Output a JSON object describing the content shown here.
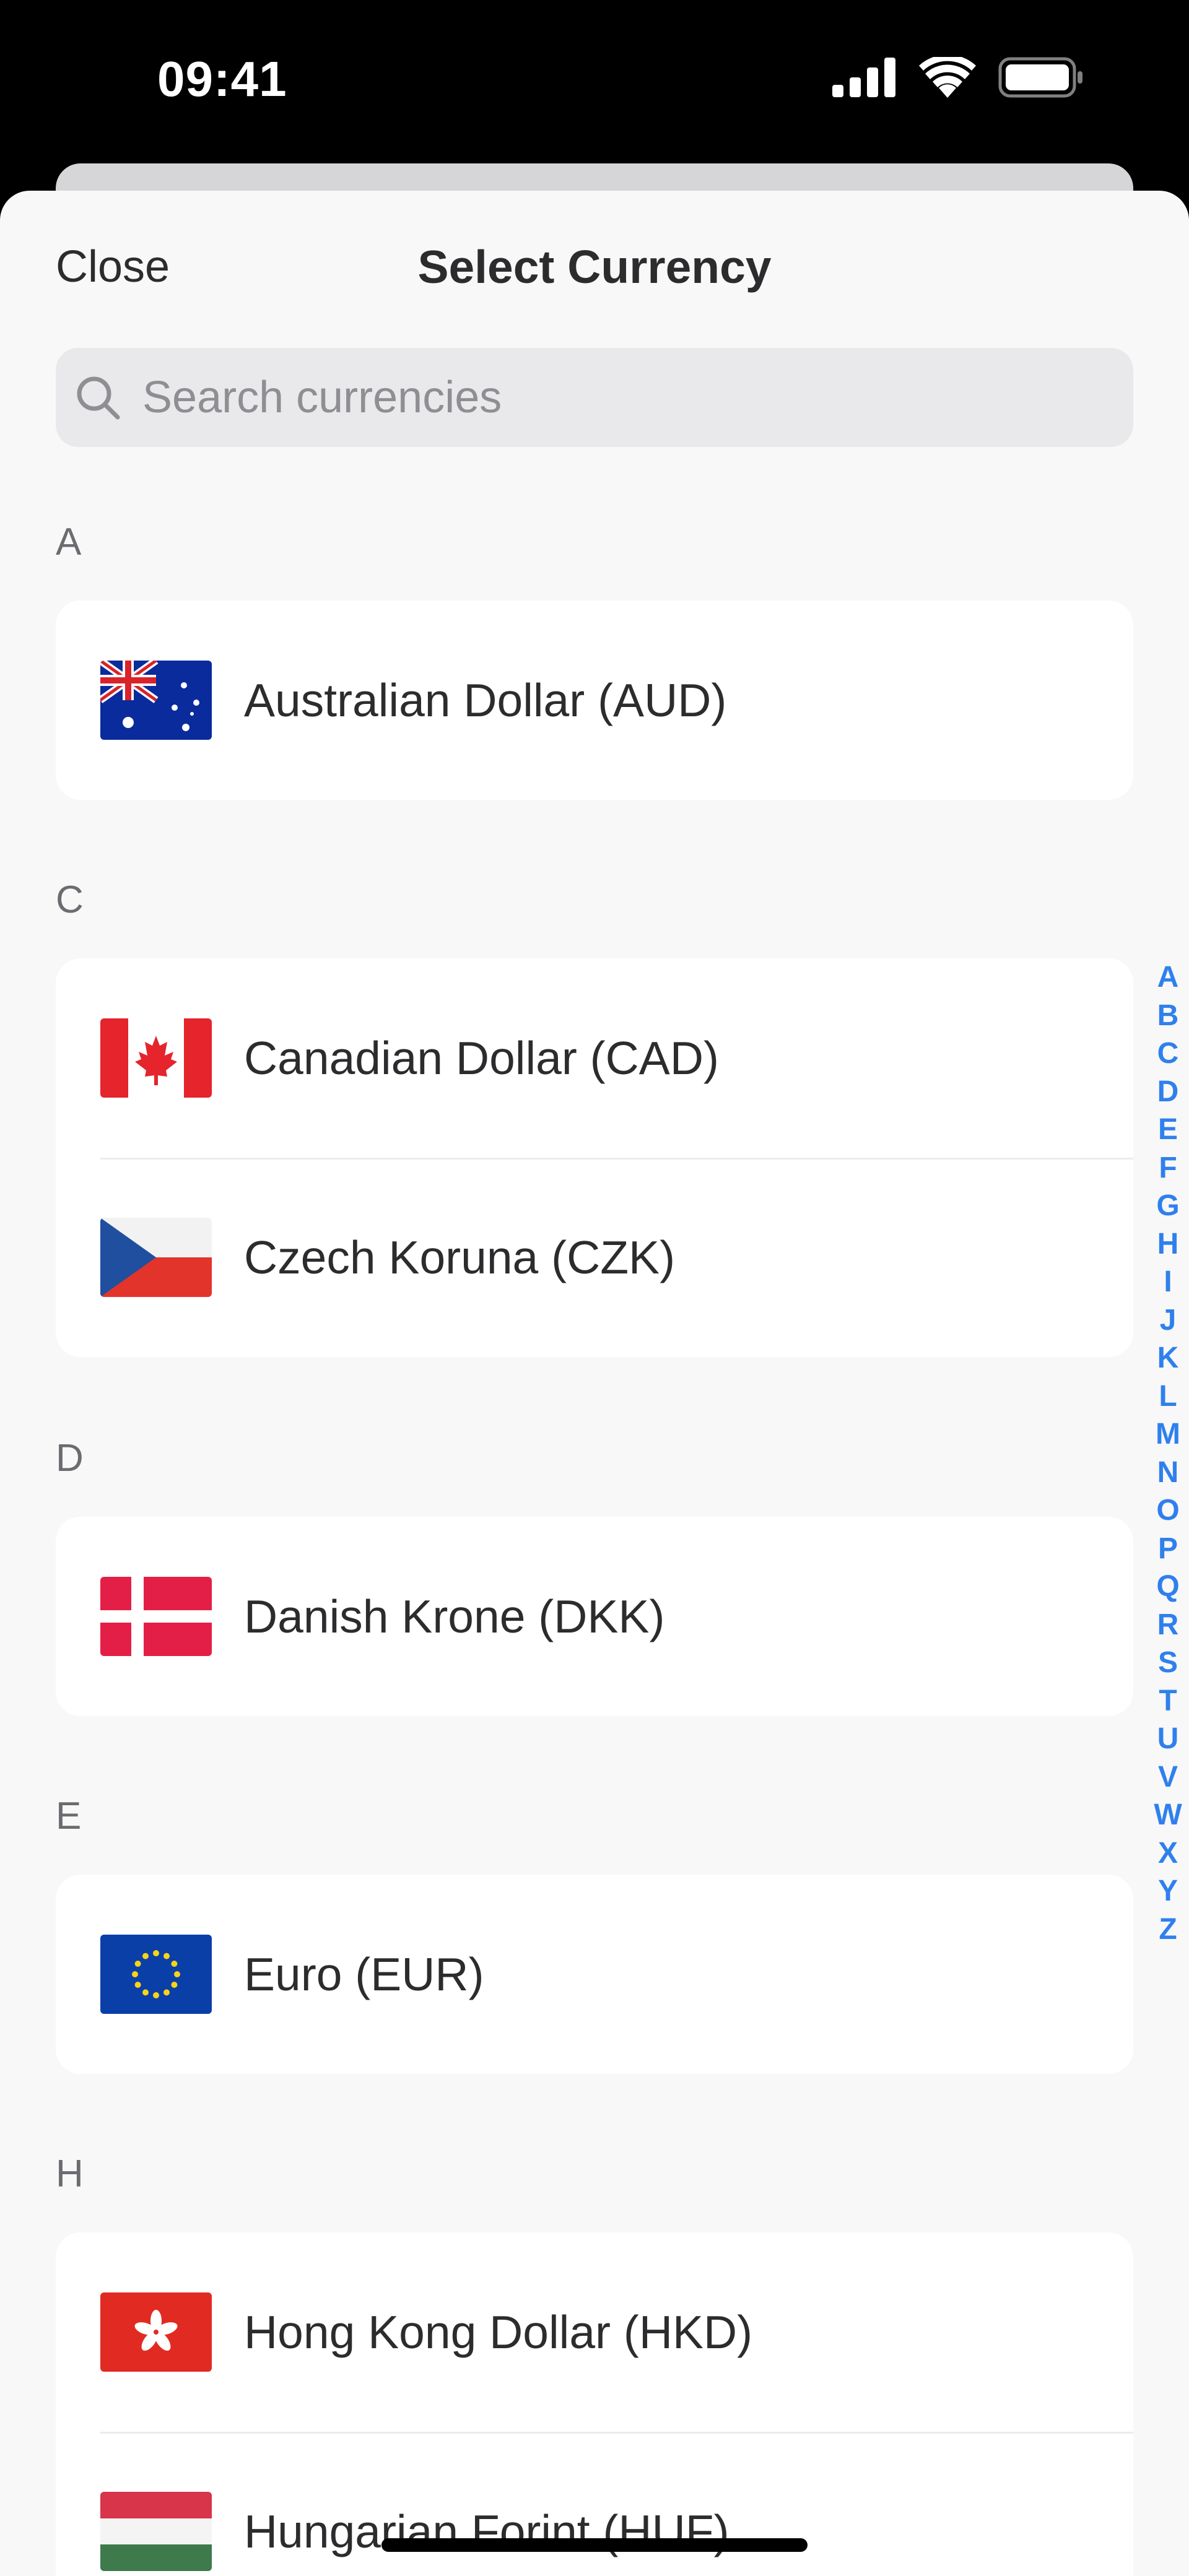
{
  "status_bar": {
    "time": "09:41"
  },
  "nav": {
    "close_label": "Close",
    "title": "Select Currency"
  },
  "search": {
    "placeholder": "Search currencies",
    "value": ""
  },
  "sections": [
    {
      "letter": "A",
      "items": [
        {
          "label": "Australian Dollar (AUD)",
          "flag": "australia-flag-icon"
        }
      ]
    },
    {
      "letter": "C",
      "items": [
        {
          "label": "Canadian Dollar (CAD)",
          "flag": "canada-flag-icon"
        },
        {
          "label": "Czech Koruna (CZK)",
          "flag": "czech-flag-icon"
        }
      ]
    },
    {
      "letter": "D",
      "items": [
        {
          "label": "Danish Krone (DKK)",
          "flag": "denmark-flag-icon"
        }
      ]
    },
    {
      "letter": "E",
      "items": [
        {
          "label": "Euro (EUR)",
          "flag": "eu-flag-icon"
        }
      ]
    },
    {
      "letter": "H",
      "items": [
        {
          "label": "Hong Kong Dollar (HKD)",
          "flag": "hong-kong-flag-icon"
        },
        {
          "label": "Hungarian Forint (HUF)",
          "flag": "hungary-flag-icon"
        }
      ]
    }
  ],
  "alpha_index": [
    "A",
    "B",
    "C",
    "D",
    "E",
    "F",
    "G",
    "H",
    "I",
    "J",
    "K",
    "L",
    "M",
    "N",
    "O",
    "P",
    "Q",
    "R",
    "S",
    "T",
    "U",
    "V",
    "W",
    "X",
    "Y",
    "Z"
  ],
  "colors": {
    "accent": "#2f80ed",
    "sheet_background": "#f8f8f8",
    "card_background": "#ffffff",
    "text": "#2c2c2e",
    "secondary_text": "#6b6b70"
  }
}
